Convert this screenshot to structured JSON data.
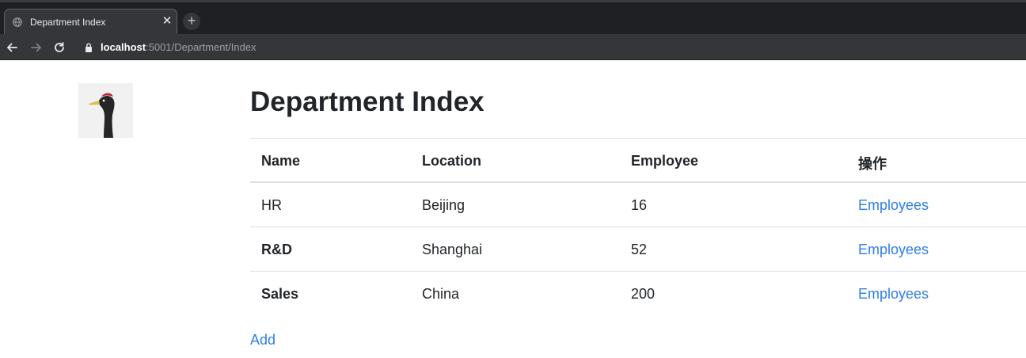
{
  "browser": {
    "tab_title": "Department Index",
    "tab_close_glyph": "✕",
    "new_tab_glyph": "+",
    "url_host": "localhost",
    "url_rest": ":5001/Department/Index"
  },
  "page": {
    "title": "Department Index",
    "columns": [
      "Name",
      "Location",
      "Employee",
      "操作"
    ],
    "rows": [
      {
        "name": "HR",
        "location": "Beijing",
        "employee": "16",
        "action": "Employees",
        "name_bold": false
      },
      {
        "name": "R&D",
        "location": "Shanghai",
        "employee": "52",
        "action": "Employees",
        "name_bold": true
      },
      {
        "name": "Sales",
        "location": "China",
        "employee": "200",
        "action": "Employees",
        "name_bold": true
      }
    ],
    "add_label": "Add"
  },
  "colors": {
    "link": "#2f7ee6",
    "text": "#212529",
    "chrome_dark": "#1f2023",
    "chrome_toolbar": "#35363a"
  },
  "icons": {
    "tab_favicon": "globe-icon",
    "back": "arrow-left-icon",
    "forward": "arrow-right-icon",
    "reload": "reload-icon",
    "secure": "lock-icon",
    "logo": "bird-logo-icon"
  }
}
